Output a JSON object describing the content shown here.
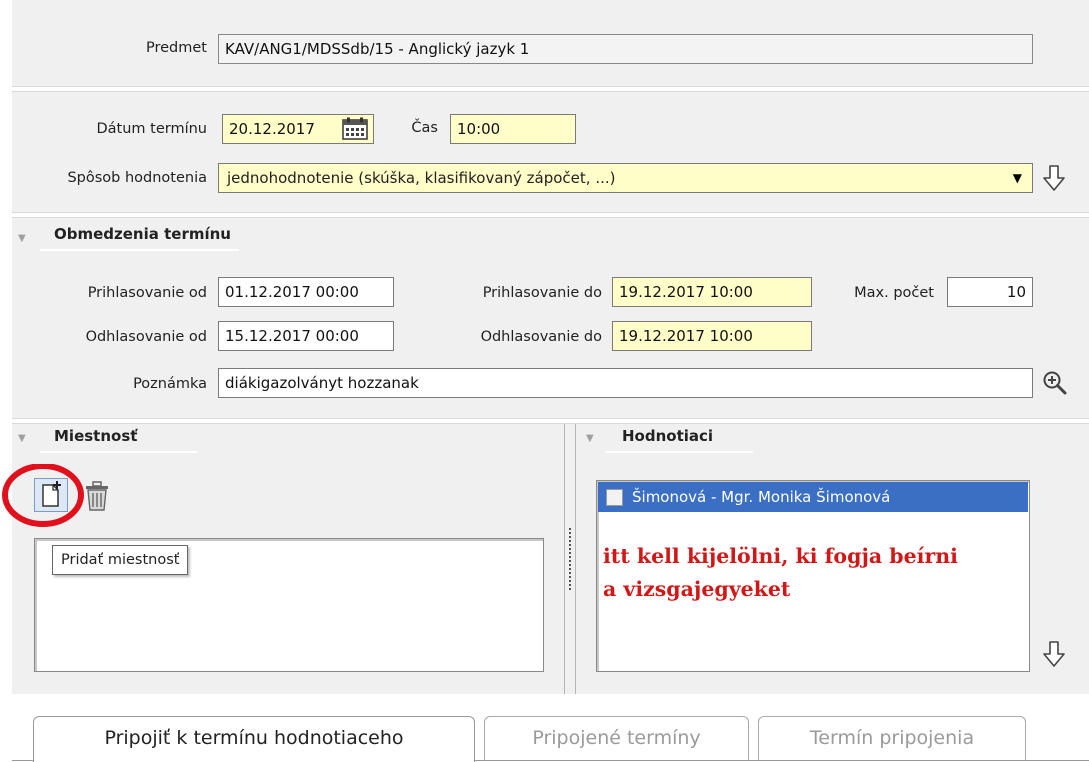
{
  "subject": {
    "label": "Predmet",
    "value": "KAV/ANG1/MDSSdb/15 - Anglický jazyk 1"
  },
  "date": {
    "label": "Dátum termínu",
    "value": "20.12.2017",
    "time_label": "Čas",
    "time_value": "10:00"
  },
  "evaluation_method": {
    "label": "Spôsob hodnotenia",
    "value": "jednohodnotenie (skúška, klasifikovaný zápočet, ...)"
  },
  "restrictions": {
    "title": "Obmedzenia termínu",
    "signup_from_label": "Prihlasovanie od",
    "signup_from_value": "01.12.2017 00:00",
    "signup_to_label": "Prihlasovanie do",
    "signup_to_value": "19.12.2017 10:00",
    "max_count_label": "Max. počet",
    "max_count_value": "10",
    "signoff_from_label": "Odhlasovanie od",
    "signoff_from_value": "15.12.2017 00:00",
    "signoff_to_label": "Odhlasovanie do",
    "signoff_to_value": "19.12.2017 10:00",
    "note_label": "Poznámka",
    "note_value": "diákigazolványt hozzanak"
  },
  "rooms": {
    "title": "Miestnosť",
    "tooltip": "Pridať miestnosť"
  },
  "evaluators": {
    "title": "Hodnotiaci",
    "items": [
      {
        "label": "Šimonová - Mgr. Monika Šimonová",
        "checked": false
      }
    ],
    "annotation_line1": "itt kell kijelölni, ki fogja beírni",
    "annotation_line2": "a vizsgajegyeket"
  },
  "tabs": [
    {
      "label": "Pripojiť  k termínu hodnotiaceho",
      "active": true
    },
    {
      "label": "Pripojené termíny",
      "active": false
    },
    {
      "label": "Termín pripojenia",
      "active": false
    }
  ],
  "colors": {
    "required_field": "#fffdc8",
    "selection": "#3a6fc4",
    "annotation": "#d01818",
    "highlight_circle": "#e0101c"
  },
  "icons": [
    "calendar-icon",
    "down-arrow-icon",
    "dropdown-arrow-icon",
    "zoom-in-icon",
    "add-room-icon",
    "trash-icon",
    "collapse-triangle-icon"
  ]
}
